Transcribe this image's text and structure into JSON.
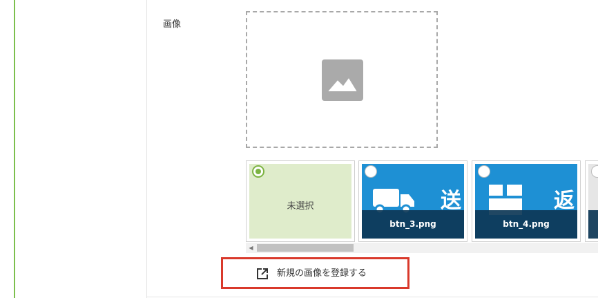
{
  "form": {
    "image_label": "画像"
  },
  "gallery": {
    "none_label": "未選択",
    "items": [
      {
        "filename": "btn_3.png",
        "kanji": "送",
        "color": "#1e90d4"
      },
      {
        "filename": "btn_4.png",
        "kanji": "返",
        "color": "#1e90d4"
      }
    ],
    "selected": "未選択"
  },
  "actions": {
    "register_label": "新規の画像を登録する"
  },
  "colors": {
    "accent_green": "#7cb342",
    "highlight_red": "#d9392b",
    "tile_blue": "#1e90d4"
  },
  "icons": {
    "placeholder": "image-placeholder-icon",
    "register": "external-link-icon"
  }
}
